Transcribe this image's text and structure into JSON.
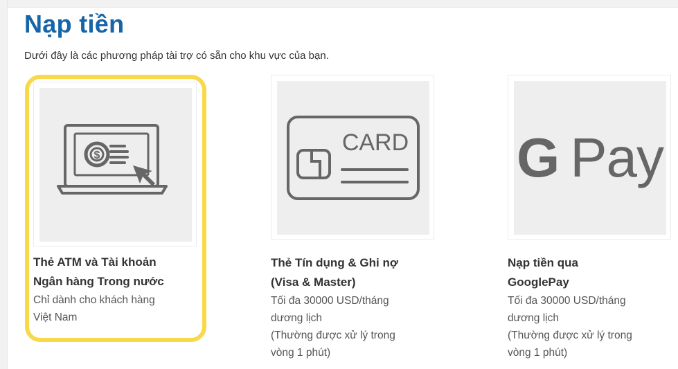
{
  "page": {
    "title": "Nạp tiền",
    "subtitle": "Dưới đây là các phương pháp tài trợ có sẵn cho khu vực của bạn."
  },
  "methods": [
    {
      "name_line1": "Thẻ ATM và Tài khoản",
      "name_line2": "Ngân hàng Trong nước",
      "desc_lines": [
        "Chỉ dành cho khách hàng",
        "Việt Nam"
      ],
      "icon": "atm-laptop-dollar-icon",
      "selected": true
    },
    {
      "name_line1": "Thẻ Tín dụng & Ghi nợ",
      "name_line2": "(Visa & Master)",
      "desc_lines": [
        "Tối đa 30000 USD/tháng",
        "dương lịch",
        "(Thường được xử lý trong",
        "vòng 1 phút)"
      ],
      "icon": "credit-card-icon",
      "icon_text": "CARD",
      "selected": false
    },
    {
      "name_line1": "Nạp tiền qua",
      "name_line2": "GooglePay",
      "desc_lines": [
        "Tối đa 30000 USD/tháng",
        "dương lịch",
        "(Thường được xử lý trong",
        "vòng 1 phút)"
      ],
      "icon": "google-pay-icon",
      "icon_text_g": "G",
      "icon_text_pay": "Pay",
      "selected": false
    }
  ],
  "colors": {
    "title": "#1565a8",
    "highlight": "#f9d84a",
    "icon": "#666666",
    "thumb_bg": "#eeeeee"
  }
}
